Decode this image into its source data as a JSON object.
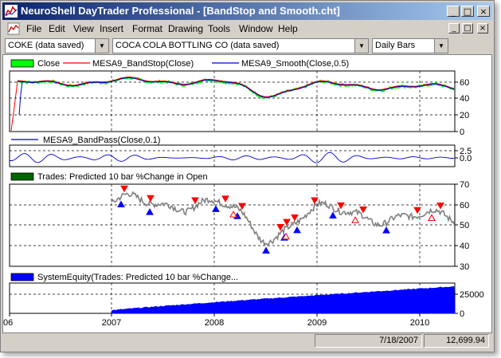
{
  "window": {
    "title": "NeuroShell DayTrader Professional - [BandStop and Smooth.cht]",
    "minimize": "_",
    "maximize": "□",
    "close": "×"
  },
  "menu": {
    "items": [
      "File",
      "Edit",
      "View",
      "Insert",
      "Format",
      "Drawing",
      "Tools",
      "Window",
      "Help"
    ]
  },
  "toolbar": {
    "symbol": "COKE (data saved)",
    "company": "COCA COLA BOTTLING CO (data saved)",
    "period": "Daily Bars"
  },
  "colors": {
    "close": "#00ff00",
    "bandstop": "#ff0000",
    "smooth": "#0000cc",
    "bandpass": "#0000cc",
    "trades_legend": "#006600",
    "equity": "#0000ff",
    "price_line": "#808080",
    "buy_marker": "#0000ff",
    "sell_marker": "#ff0000"
  },
  "panes": {
    "price": {
      "legend": [
        "Close",
        "MESA9_BandStop(Close)",
        "MESA9_Smooth(Close,0.5)"
      ],
      "yticks": [
        "60",
        "40",
        "20",
        "0"
      ]
    },
    "bandpass": {
      "legend": [
        "MESA9_BandPass(Close,0.1)"
      ],
      "yticks": [
        "2.5",
        "0.0"
      ]
    },
    "trades": {
      "legend": [
        "Trades: Predicted 10 bar %Change in Open"
      ],
      "yticks": [
        "70",
        "60",
        "50",
        "40",
        "30"
      ]
    },
    "equity": {
      "legend": [
        "SystemEquity(Trades: Predicted 10 bar %Change..."
      ],
      "yticks": [
        "25000",
        "0"
      ]
    }
  },
  "xaxis": {
    "ticks": [
      "06",
      "2007",
      "2008",
      "2009",
      "2010"
    ]
  },
  "status": {
    "date": "7/18/2007",
    "value": "12,699.94"
  }
}
